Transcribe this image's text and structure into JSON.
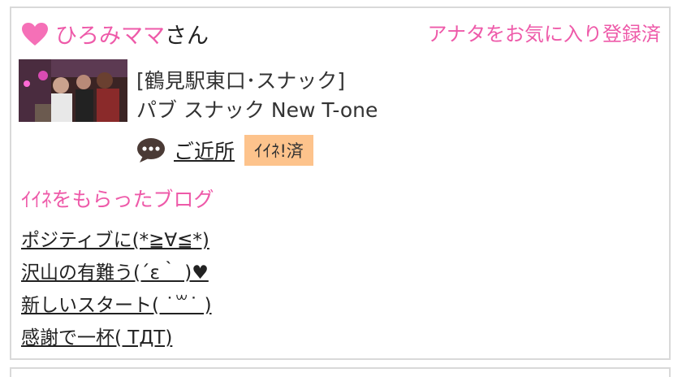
{
  "user": {
    "name": "ひろみママ",
    "suffix": "さん",
    "favorite_status": "アナタをお気に入り登録済"
  },
  "shop": {
    "category": "[鶴見駅東口･スナック]",
    "name": "パブ スナック New T-one",
    "proximity_label": "ご近所",
    "like_badge": "ｲｲﾈ!済"
  },
  "blogs": {
    "heading": "ｲｲﾈをもらったブログ",
    "items": [
      {
        "title": "ポジティブに(*≧∀≦*)"
      },
      {
        "title": "沢山の有難う(´ε｀ )♥"
      },
      {
        "title": "新しいスタート( ˙꒳˙ )"
      },
      {
        "title": "感謝で一杯( TДT)"
      }
    ]
  },
  "colors": {
    "accent_pink": "#ee5aa9",
    "badge_orange": "#fdc38c",
    "border_gray": "#d9d9d9"
  },
  "icons": {
    "heart": "heart-icon",
    "chat": "speech-bubble-icon"
  }
}
